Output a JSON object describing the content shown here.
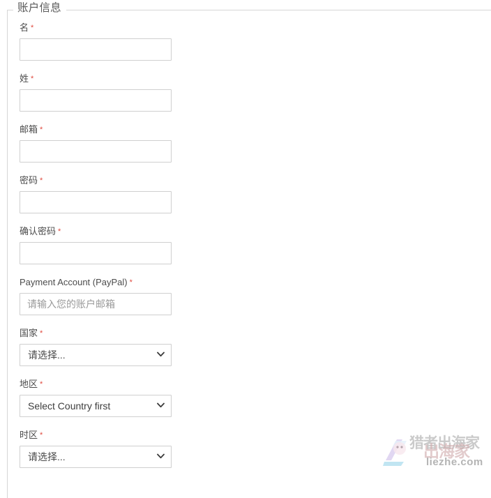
{
  "fieldset": {
    "legend": "账户信息"
  },
  "required_marker": "*",
  "fields": [
    {
      "key": "first_name",
      "label": "名",
      "required": true,
      "control": "text",
      "value": "",
      "placeholder": ""
    },
    {
      "key": "last_name",
      "label": "姓",
      "required": true,
      "control": "text",
      "value": "",
      "placeholder": ""
    },
    {
      "key": "email",
      "label": "邮箱",
      "required": true,
      "control": "text",
      "value": "",
      "placeholder": ""
    },
    {
      "key": "password",
      "label": "密码",
      "required": true,
      "control": "password",
      "value": "",
      "placeholder": ""
    },
    {
      "key": "confirm_password",
      "label": "确认密码",
      "required": true,
      "control": "password",
      "value": "",
      "placeholder": ""
    },
    {
      "key": "payment_account",
      "label": "Payment Account (PayPal)",
      "required": true,
      "control": "text",
      "value": "",
      "placeholder": "请输入您的账户邮箱"
    },
    {
      "key": "country",
      "label": "国家",
      "required": true,
      "control": "select",
      "selected": "请选择..."
    },
    {
      "key": "region",
      "label": "地区",
      "required": true,
      "control": "select",
      "selected": "Select Country first"
    },
    {
      "key": "timezone",
      "label": "时区",
      "required": true,
      "control": "select",
      "selected": "请选择..."
    }
  ],
  "icons": {
    "chevron_down": "chevron-down-icon"
  },
  "watermark": {
    "brand_cn": "猎者出海家",
    "brand_cn_overlay": "出海家",
    "domain": "liezhe.com"
  },
  "colors": {
    "required_asterisk": "#e04a3f",
    "label_text": "#4c4c4c",
    "border": "#cfcfcf",
    "fieldset_border": "#d6d6d6",
    "placeholder": "#9a9a9a",
    "background": "#ffffff"
  }
}
